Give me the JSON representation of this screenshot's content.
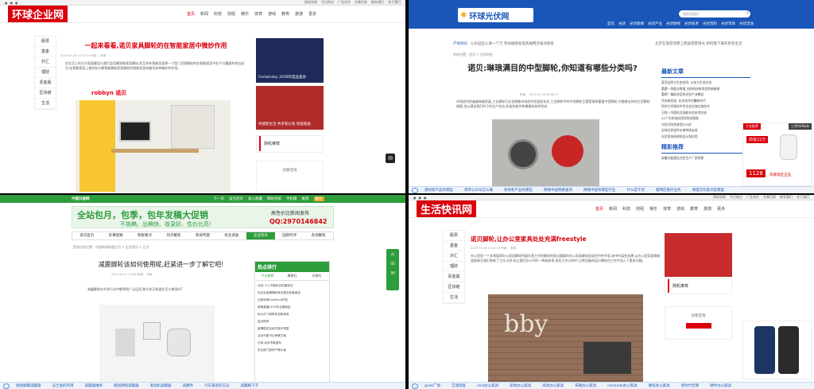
{
  "tl": {
    "topbar": [
      "网站导航",
      "今日热点",
      "广告合作",
      "文章目录",
      "联系我们",
      "关于我们"
    ],
    "logo": "环球企业网",
    "nav": [
      "首页",
      "新闻",
      "科技",
      "财经",
      "娱乐",
      "体育",
      "游戏",
      "教育",
      "旅游",
      "更多"
    ],
    "side": [
      "股票",
      "基金",
      "外汇",
      "理财",
      "贵金属",
      "区块链",
      "生活"
    ],
    "title": "一起来看看,诺贝家具脚轮的在智能家居中微妙作用",
    "meta": "2019-10-28 17:12:04  作者：  来源：",
    "para": "在生活上的方方面面都会与我们会用着智能家居脚轮,而且年年智能家居那一个西门活脱脚轮的在智能家居中在千分重要的地位因为,在智能家居上使所有方都智能脚轮家居脚轮的智能家居有着也有种微妙的作用。",
    "news": [
      "Certainday 2019年度品鉴会",
      "共建新生活 共享新价值 智能家居"
    ],
    "tab": "随机推荐",
    "cta": "创意咨询",
    "ad_label": "robbyn 诺贝"
  },
  "tr": {
    "logo": "环球光伏网",
    "search_placeholder": "搜索关键词",
    "nav": [
      "首页",
      "光伏",
      "光伏新闻",
      "光伏产业",
      "光伏财经",
      "光伏技术",
      "光伏百科",
      "光伏市场",
      "光伏活动"
    ],
    "hot_label": "产经快讯",
    "hot_text": "以乐园出入境一个万  参加福建省电商展网页展对接会",
    "hot_right": "北京在旅游消费上稳居游客目光 如何能下来的更多生活",
    "crumb": "你的位置：首页 > 光伏财经",
    "title": "诺贝:琳琅满目的中型脚轮,你知道有哪些分类吗?",
    "meta": "来源：   2019-10-09 16:06:27",
    "para": "市场经济优越越来越发展,工业脚轮行业也随着市场经济发展变化化,工业脚轮中的中型脚轮主要是指承重量中型脚轮,它能够支持的主型脚轮规格,也以满足我们的下的生产机台,机架的组件和需要有各种形态",
    "latest_title": "最新文章",
    "latest": [
      "宣武自然与生态空间: 从化与生态文化",
      "重要一季度业财报,光阳科技研发投资新能源",
      "重磅！精彩纷呈的光伏产业峰会",
      "开启新征程: 在化合作共赢新时代",
      "同济大学高校中华文化交流文旅合作",
      "万物 | 中国的太阳能光伏技术应该",
      "54个光伏电站项目纷纷落地",
      "光伏方阵到底用什么好",
      "全球光伏组件价格持续走低",
      "光伏发电系统的设计和应用"
    ],
    "recommend_title": "精彩推荐",
    "recommend_item": "安徽天能建设光伏生产厂家初期",
    "ad_badge_left": "七仓推荐",
    "ad_badge_right": "三代AirPods",
    "ad_price": "劲省22万",
    "ad_bottom": "风暴限定正品",
    "ad_value": "1128",
    "bottom": [
      "建材新产品有哪些",
      "保单公众号怎么做",
      "防伪新产品有哪些",
      "网端中国铁路查询",
      "网端中国有哪些行业",
      "什么是干货",
      "最网店重庆业务",
      "清理方向基点是哪里"
    ]
  },
  "bl": {
    "brand": "中国日报网",
    "top_links": [
      "下一页",
      "设为首页",
      "加入收藏",
      "网站导航",
      "手机版",
      "推荐",
      "报名"
    ],
    "ad_main": "全站包月，包季，包年发稿大促销",
    "ad_sub": "不挑稿、出稿快、收录好、性价比高!",
    "ad_right_title": "高性价比新闻发布",
    "ad_qq": "QQ:2970146842",
    "nav": [
      "资讯首页",
      "军事观察",
      "明星看点",
      "热点聚焦",
      "新闻专题",
      "民生调查",
      "企业资讯",
      "国际时评",
      "各地聚焦"
    ],
    "crumb": "您现在的位置：中国新闻联盟主页 > 企业资讯 > 正文",
    "title": "减震脚轮该如何使用呢,赶紧进一步了解它吧!",
    "meta": "2019-10-17 13:08  来源：  作者：",
    "para": "减震脚轮在许多行业中都得到广泛运用,那么你又知道它怎么使用吗?",
    "hot_title": "热点排行",
    "hot_tabs": [
      "今日推荐",
      "周排行",
      "月排行"
    ],
    "hot_items": [
      "北京:个人不能私自拍摄违法",
      "在北京疫情期间有无数志愿者奋战",
      "比较特别ForeFund开发",
      "新闻直播2019年全国两会",
      "科大讯飞将带来全新体验",
      "会议现场",
      "疫情稳定后经济逐步恢复",
      "北京市委书记考察古城",
      "日前,北京市委宣布",
      "农业部门宣布产粮大省"
    ],
    "bottom": [
      "规划脚震减震器",
      "法兰盘的作用",
      "减震器维修",
      "规划牌照减震器",
      "发动机减震器",
      "减震件",
      "汽车悬架的方法",
      "减震脚下子"
    ]
  },
  "br": {
    "topbar": [
      "网站导航",
      "今日热点",
      "广告合作",
      "文章目录",
      "联系我们",
      "关于我们"
    ],
    "logo": "生活快讯网",
    "nav": [
      "首页",
      "新闻",
      "科技",
      "财经",
      "娱乐",
      "体育",
      "游戏",
      "教育",
      "旅游",
      "更多"
    ],
    "side": [
      "股票",
      "基金",
      "外汇",
      "理财",
      "贵金属",
      "区块链",
      "生活"
    ],
    "title": "诺贝脚轮,让办公室家具处处充满freestyle",
    "meta": "2019-11-06 13:44:03  作者：  来源：",
    "para": "办公室是一个非常值得办公家居脚轮所要负责工作的脚轮的相当重要的办公家具脚轮家居所中的专家,其中的某些选择,以办公室家居脚轮变换和为我们带来了工作,另外也让我们办公中的一种高效率,如在工作计划中,日常设备的运行脚轮在工作中加入了更多功能。",
    "tab": "随机推荐",
    "cta": "创意咨询",
    "bottom": [
      "geek广场",
      "艾瑞调查",
      "vlcd办公家具",
      "知你办公家具",
      "高效办公家具",
      "布朗办公家具",
      "nmleadk办公家具",
      "硬核办公家具",
      "新时代控制",
      "硬件办公家具"
    ]
  }
}
